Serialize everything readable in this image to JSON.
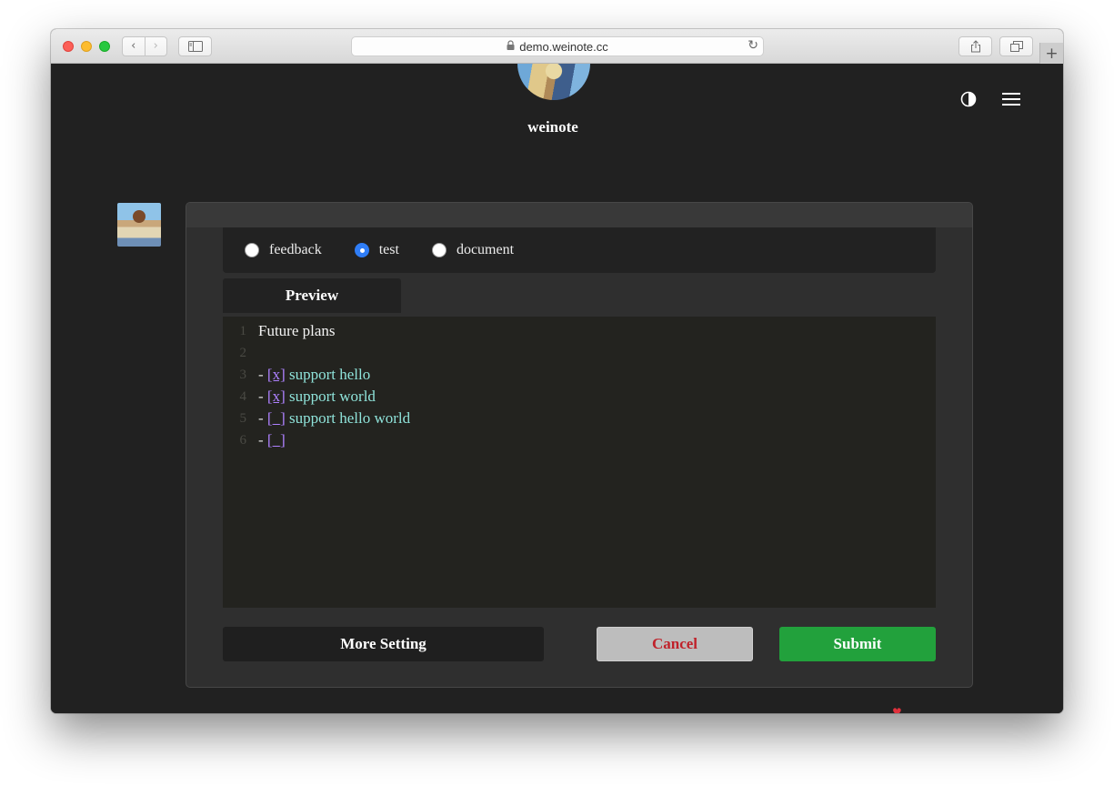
{
  "browser": {
    "url": "demo.weinote.cc",
    "nav_back": "‹",
    "nav_forward": "›",
    "new_tab": "+"
  },
  "site": {
    "name": "weinote"
  },
  "composer": {
    "categories": [
      {
        "label": "feedback",
        "checked": false
      },
      {
        "label": "test",
        "checked": true
      },
      {
        "label": "document",
        "checked": false
      }
    ],
    "preview_label": "Preview",
    "editor_lines": [
      {
        "num": "1",
        "text": "Future plans"
      },
      {
        "num": "2",
        "text": ""
      },
      {
        "num": "3",
        "dash": "- ",
        "check": "[x]",
        "task": " support hello"
      },
      {
        "num": "4",
        "dash": "- ",
        "check": "[x]",
        "task": " support world"
      },
      {
        "num": "5",
        "dash": "- ",
        "check": "[_]",
        "task": " support hello world"
      },
      {
        "num": "6",
        "dash": "- ",
        "check": "[_]",
        "task": ""
      }
    ],
    "more_setting_label": "More Setting",
    "cancel_label": "Cancel",
    "submit_label": "Submit"
  },
  "colors": {
    "background": "#212121",
    "panel": "#2f2f2f",
    "accent_radio": "#2f7df6",
    "submit": "#22a13c",
    "cancel_text": "#c0212a",
    "task_text": "#8fe3da",
    "checkbox_text": "#ae81ff"
  }
}
